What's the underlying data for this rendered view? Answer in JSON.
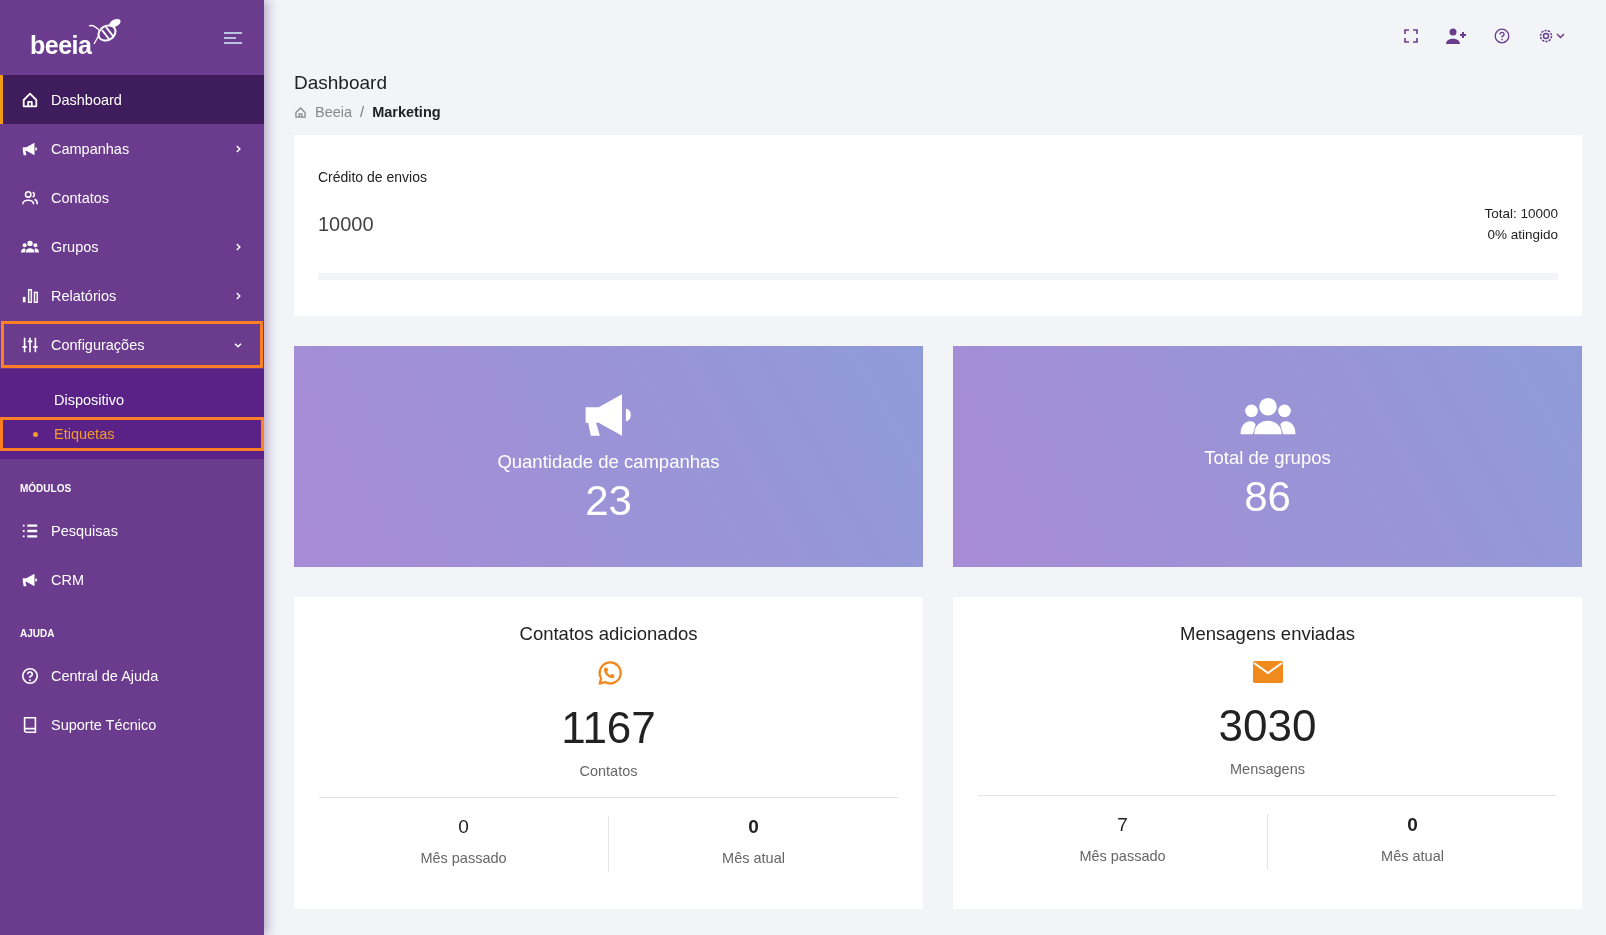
{
  "brand": {
    "logo_text": "beeia"
  },
  "sidebar": {
    "menu": [
      {
        "label": "Dashboard",
        "selected": true,
        "outlined": false
      },
      {
        "label": "Campanhas",
        "selected": false,
        "outlined": false,
        "expanded": false
      },
      {
        "label": "Contatos",
        "selected": false,
        "outlined": false
      },
      {
        "label": "Grupos",
        "selected": false,
        "outlined": false,
        "expanded": false
      },
      {
        "label": "Relatórios",
        "selected": false,
        "outlined": false,
        "expanded": false
      },
      {
        "label": "Configurações",
        "selected": false,
        "outlined": true,
        "expanded": true,
        "children": [
          {
            "label": "Dispositivo",
            "selected": false,
            "outlined": false
          },
          {
            "label": "Etiquetas",
            "selected": true,
            "outlined": true
          }
        ]
      }
    ],
    "sections": [
      {
        "title": "MÓDULOS",
        "items": [
          {
            "label": "Pesquisas"
          },
          {
            "label": "CRM"
          }
        ]
      },
      {
        "title": "AJUDA",
        "items": [
          {
            "label": "Central de Ajuda"
          },
          {
            "label": "Suporte Técnico"
          }
        ]
      }
    ]
  },
  "page_title": "Dashboard",
  "breadcrumb": [
    {
      "label": "Beeia",
      "current": false
    },
    {
      "label": "Marketing",
      "current": true,
      "separator": "/"
    }
  ],
  "credit": {
    "title": "Crédito de envios",
    "value": "10000",
    "total": "Total: 10000",
    "progress_text": "0% atingido",
    "level": 0
  },
  "highlight_cards": [
    {
      "title": "Quantidade de campanhas",
      "value": "23"
    },
    {
      "title": "Total de grupos",
      "value": "86"
    }
  ],
  "stat_cards": [
    {
      "title": "Contatos adicionados",
      "value": "1167",
      "unit": "Contatos",
      "breakdown": [
        {
          "value": "0",
          "label": "Mês passado"
        },
        {
          "value": "0",
          "label": "Mês atual"
        }
      ]
    },
    {
      "title": "Mensagens enviadas",
      "value": "3030",
      "unit": "Mensagens",
      "breakdown": [
        {
          "value": "7",
          "label": "Mês passado"
        },
        {
          "value": "0",
          "label": "Mês atual"
        }
      ]
    }
  ]
}
